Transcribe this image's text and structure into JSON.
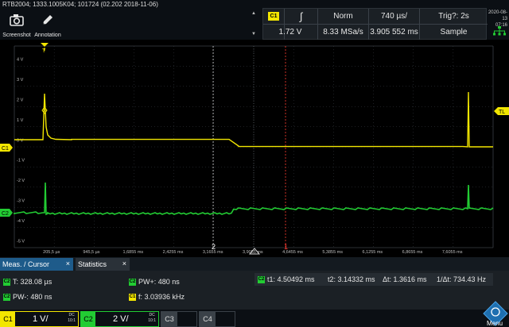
{
  "device_title": "RTB2004; 1333.1005K04; 101724 (02.202 2018-11-06)",
  "toolbar": {
    "screenshot_label": "Screenshot",
    "annotation_label": "Annotation"
  },
  "settings": {
    "channel_badge": "C1",
    "trigger_slope_symbol": "∫",
    "trigger_mode": "Norm",
    "timebase": "740 µs/",
    "trigger_source": "Trig?: 2s",
    "trigger_level": "1.72 V",
    "sample_rate": "8.33 MSa/s",
    "horizontal_position": "3.905 552 ms",
    "acquisition_mode": "Sample"
  },
  "datetime": {
    "date": "2020-08-13",
    "time": "07:16"
  },
  "waveform": {
    "y_labels": [
      "4 V",
      "3 V",
      "2 V",
      "1 V",
      "0 V",
      "-1 V",
      "-2 V",
      "-3 V",
      "-4 V",
      "-5 V"
    ],
    "x_labels": [
      "205,5 µs",
      "945,5 µs",
      "1,6855 ms",
      "2,4255 ms",
      "3,1655 ms",
      "3,9055 ms",
      "4,6455 ms",
      "5,3855 ms",
      "6,1255 ms",
      "6,8655 ms",
      "7,6055 ms"
    ],
    "ch1_marker": "C1",
    "ch2_marker": "C2",
    "trigger_level_marker": "TL",
    "trigger_marker": "T",
    "cursor1_label": "1",
    "cursor2_label": "2",
    "colors": {
      "ch1": "#f2e600",
      "ch2": "#22cc33",
      "grid": "#3a3f46",
      "cursor": "#ff3b30"
    }
  },
  "measurement_panel": {
    "tab_meas_label": "Meas. / Cursor",
    "tab_stats_label": "Statistics",
    "close_symbol": "×",
    "period": "T: 328.08 µs",
    "neg_width": "PW-: 480 ns",
    "pos_width": "PW+: 480 ns",
    "frequency": "f: 3.03936 kHz",
    "cursor_t1": "t1: 4.50492 ms",
    "cursor_t2": "t2: 3.14332 ms",
    "cursor_dt": "Δt: 1.3616 ms",
    "cursor_inv_dt": "1/Δt: 734.43 Hz"
  },
  "channels": {
    "c1": {
      "tag": "C1",
      "scale": "1 V/",
      "coupling": "DC",
      "bw": "10:1"
    },
    "c2": {
      "tag": "C2",
      "scale": "2 V/",
      "coupling": "DC",
      "bw": "10:1"
    },
    "c3": {
      "tag": "C3"
    },
    "c4": {
      "tag": "C4"
    }
  },
  "menu_label": "Menu"
}
